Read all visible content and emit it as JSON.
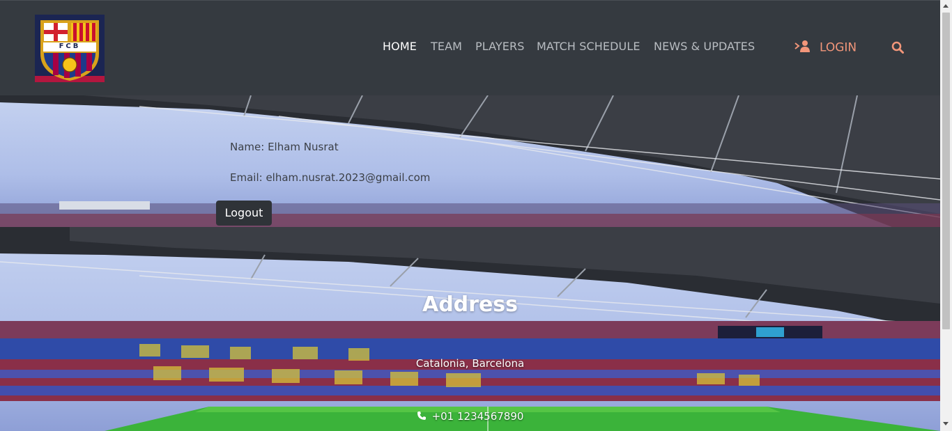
{
  "header": {
    "logo_text": "FCB",
    "nav": [
      {
        "label": "HOME",
        "active": true
      },
      {
        "label": "TEAM",
        "active": false
      },
      {
        "label": "PLAYERS",
        "active": false
      },
      {
        "label": "MATCH SCHEDULE",
        "active": false
      },
      {
        "label": "NEWS & UPDATES",
        "active": false
      }
    ],
    "login_label": "LOGIN",
    "login_icon": "user-login-icon",
    "search_icon": "search-icon"
  },
  "profile": {
    "name_line": "Name: Elham Nusrat",
    "email_line": "Email: elham.nusrat.2023@gmail.com",
    "logout_label": "Logout"
  },
  "contact": {
    "title": "Address",
    "address": "Catalonia, Barcelona",
    "phone": "+01 1234567890",
    "phone_icon": "phone-icon"
  },
  "colors": {
    "header_bg": "#353a40",
    "nav_active": "#ffffff",
    "nav_inactive": "#b9bdc2",
    "login_accent": "#f2967a",
    "button_bg": "#2f3338"
  }
}
